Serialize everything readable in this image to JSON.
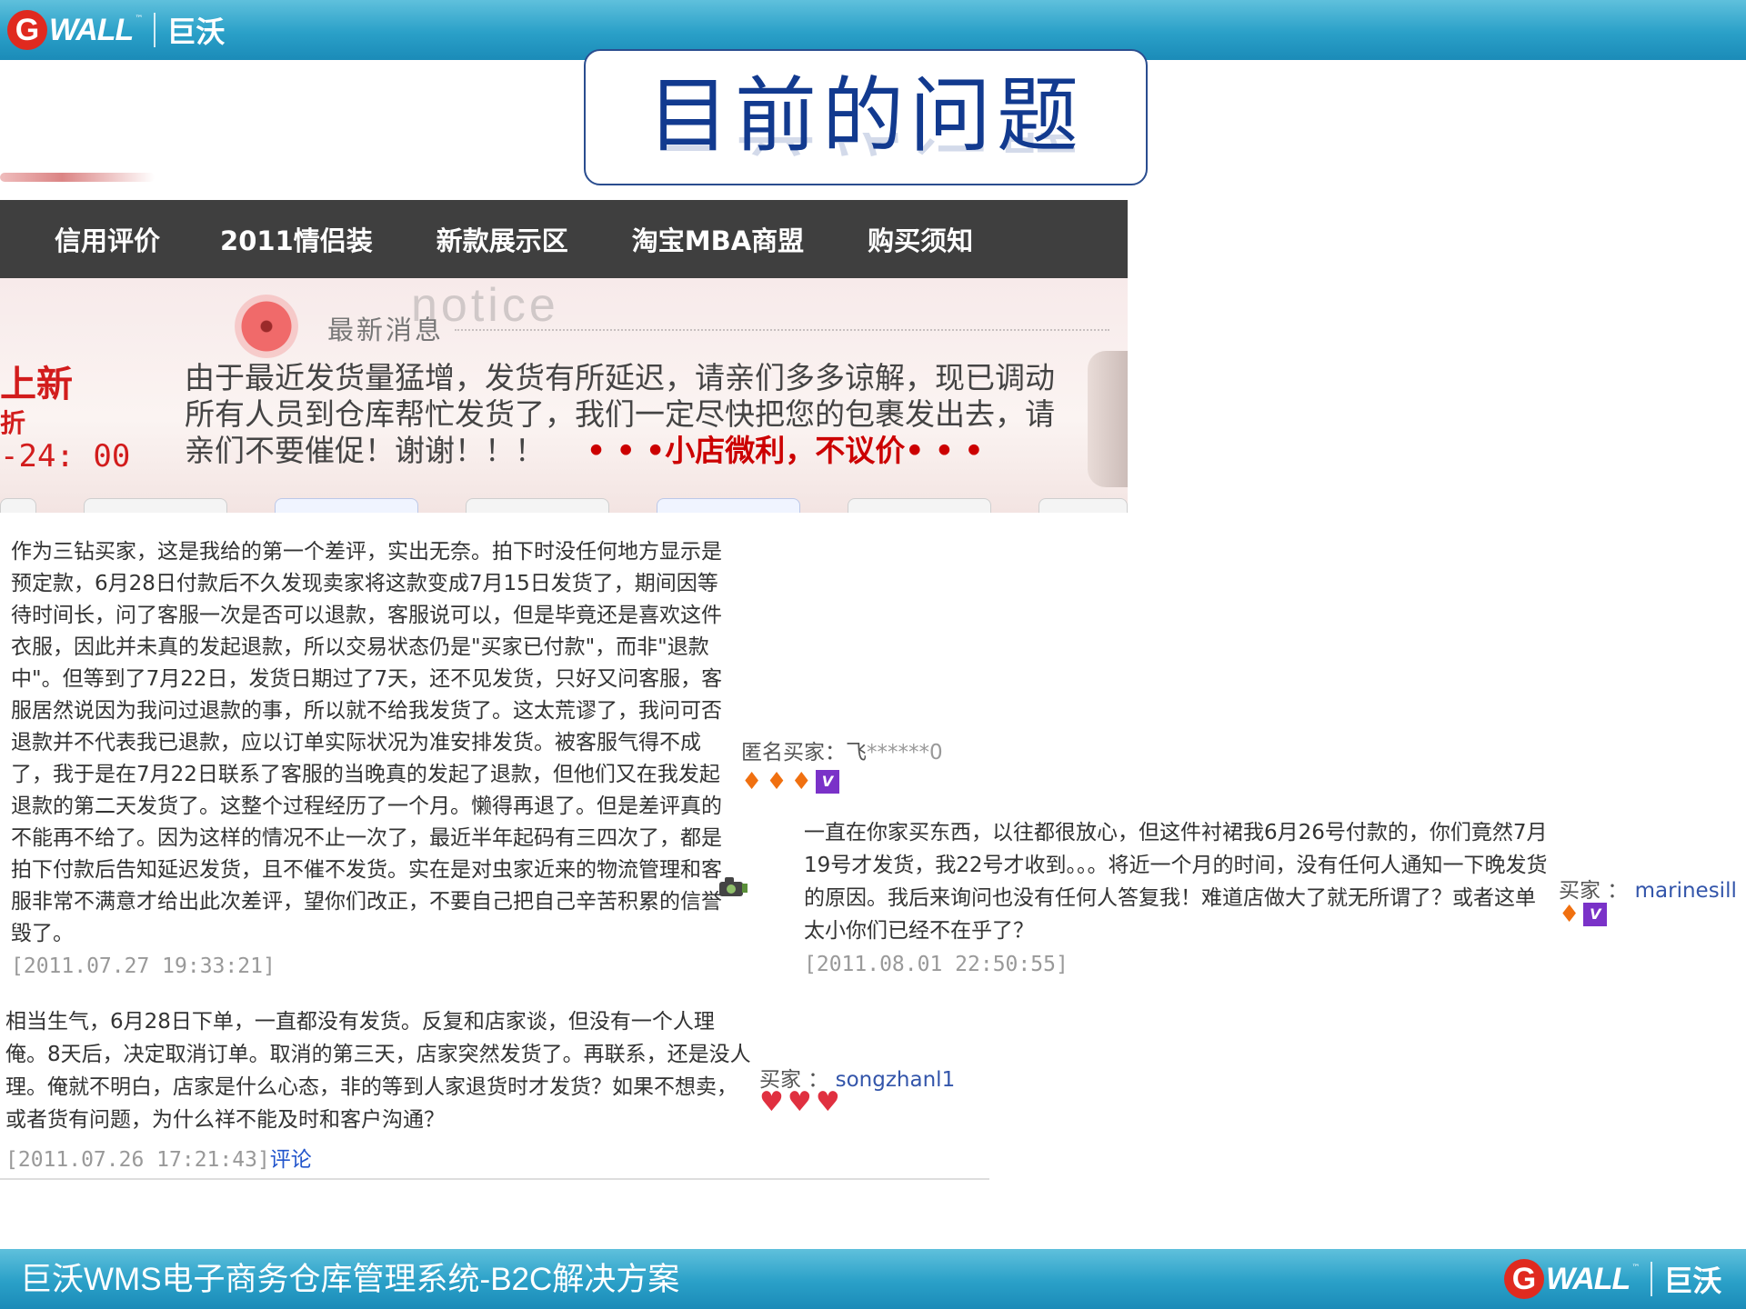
{
  "brand": {
    "g_letter": "G",
    "wall": "WALL",
    "tm": "™",
    "cn": "巨沃"
  },
  "colors": {
    "bar_blue": "#2aa0c8",
    "title_blue": "#123a8f",
    "nav_gray": "#3f3f3f",
    "accent_red": "#cc0000",
    "link_blue": "#2255cc"
  },
  "slide": {
    "title": "目前的问题",
    "footer": "巨沃WMS电子商务仓库管理系统-B2C解决方案"
  },
  "shop": {
    "nav": [
      "信用评价",
      "2011情侣装",
      "新款展示区",
      "淘宝MBA商盟",
      "购买须知"
    ],
    "notice_heading": "最新消息",
    "notice_word": "notice",
    "side_lines": [
      "上新",
      "折",
      "-24: 00"
    ],
    "notice_body": "由于最近发货量猛增，发货有所延迟，请亲们多多谅解，现已调动所有人员到仓库帮忙发货了，我们一定尽快把您的包裹发出去，请亲们不要催促！谢谢！！！",
    "notice_slogan": "• • •小店微利，不议价• • •"
  },
  "reviews": [
    {
      "text": "作为三钻买家，这是我给的第一个差评，实出无奈。拍下时没任何地方显示是预定款，6月28日付款后不久发现卖家将这款变成7月15日发货了，期间因等待时间长，问了客服一次是否可以退款，客服说可以，但是毕竟还是喜欢这件衣服，因此并未真的发起退款，所以交易状态仍是\"买家已付款\"，而非\"退款中\"。但等到了7月22日，发货日期过了7天，还不见发货，只好又问客服，客服居然说因为我问过退款的事，所以就不给我发货了。这太荒谬了，我问可否退款并不代表我已退款，应以订单实际状况为准安排发货。被客服气得不成了，我于是在7月22日联系了客服的当晚真的发起了退款，但他们又在我发起退款的第二天发货了。这整个过程经历了一个月。懒得再退了。但是差评真的不能再不给了。因为这样的情况不止一次了，最近半年起码有三四次了，都是拍下付款后告知延迟发货，且不催不发货。实在是对虫家近来的物流管理和客服非常不满意才给出此次差评，望你们改正，不要自己把自己辛苦积累的信誉毁了。",
      "time": "[2011.07.27 19:33:21]",
      "buyer_label": "匿名买家：",
      "buyer_name": "飞",
      "buyer_mask": "******0"
    },
    {
      "text": "一直在你家买东西，以往都很放心，但这件衬裙我6月26号付款的，你们竟然7月19号才发货，我22号才收到。。。将近一个月的时间，没有任何人通知一下晚发货的原因。我后来询问也没有任何人答复我！难道店做大了就无所谓了？或者这单太小你们已经不在乎了？",
      "time": "[2011.08.01 22:50:55]",
      "buyer_label": "买家 ：",
      "buyer_name": "marinesill"
    },
    {
      "text": "相当生气，6月28日下单，一直都没有发货。反复和店家谈，但没有一个人理俺。8天后，决定取消订单。取消的第三天，店家突然发货了。再联系，还是没人理。俺就不明白，店家是什么心态，非的等到人家退货时才发货？如果不想卖，或者货有问题，为什么祥不能及时和客户沟通？",
      "time": "[2011.07.26 17:21:43]",
      "comment_link": "评论",
      "buyer_label": "买家 ：",
      "buyer_name": "songzhanl1"
    }
  ],
  "icons": {
    "diamond": "diamond-icon",
    "heart": "heart-icon",
    "vip": "vip-badge-icon",
    "camera": "camera-icon"
  }
}
